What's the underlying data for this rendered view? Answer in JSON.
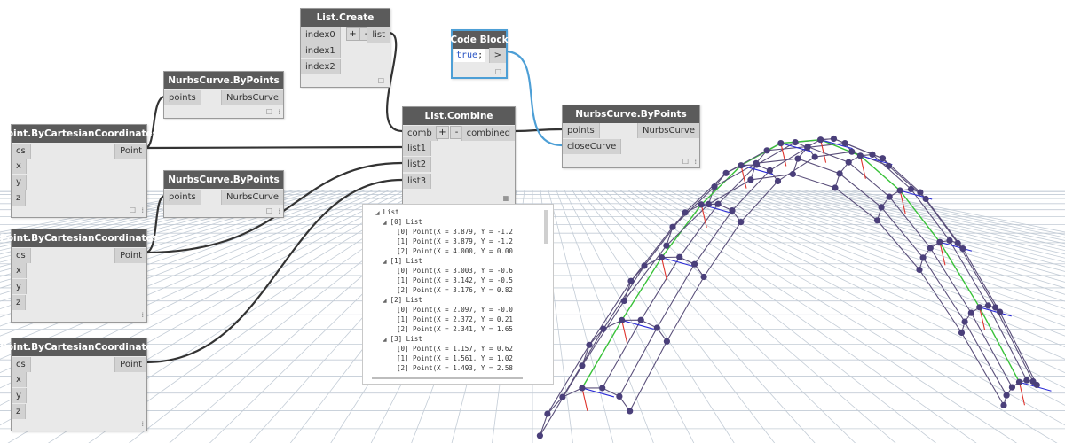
{
  "nodes": {
    "point1": {
      "title": "Point.ByCartesianCoordinates",
      "inputs": [
        "cs",
        "x",
        "y",
        "z"
      ],
      "output": "Point"
    },
    "point2": {
      "title": "Point.ByCartesianCoordinates",
      "inputs": [
        "cs",
        "x",
        "y",
        "z"
      ],
      "output": "Point"
    },
    "point3": {
      "title": "Point.ByCartesianCoordinates",
      "inputs": [
        "cs",
        "x",
        "y",
        "z"
      ],
      "output": "Point"
    },
    "nurbs1": {
      "title": "NurbsCurve.ByPoints",
      "inputs": [
        "points"
      ],
      "output": "NurbsCurve"
    },
    "nurbs2": {
      "title": "NurbsCurve.ByPoints",
      "inputs": [
        "points"
      ],
      "output": "NurbsCurve"
    },
    "nurbs3": {
      "title": "NurbsCurve.ByPoints",
      "inputs": [
        "points",
        "closeCurve"
      ],
      "output": "NurbsCurve"
    },
    "list_create": {
      "title": "List.Create",
      "inputs": [
        "index0",
        "index1",
        "index2"
      ],
      "output": "list",
      "plus": "+",
      "minus": "-"
    },
    "list_combine": {
      "title": "List.Combine",
      "inputs": [
        "comb",
        "list1",
        "list2",
        "list3"
      ],
      "output": "combined",
      "plus": "+",
      "minus": "-"
    },
    "code_block": {
      "title": "Code Block",
      "code_keyword": "true",
      "code_suffix": ";",
      "output": ">"
    }
  },
  "watch": {
    "lines": [
      {
        "text": "List",
        "indent": 0,
        "toggle": true
      },
      {
        "text": "[0] List",
        "indent": 1,
        "toggle": true
      },
      {
        "text": "[0] Point(X = 3.879, Y = -1.2",
        "indent": 3,
        "toggle": false
      },
      {
        "text": "[1] Point(X = 3.879, Y = -1.2",
        "indent": 3,
        "toggle": false
      },
      {
        "text": "[2] Point(X = 4.000, Y = 0.00",
        "indent": 3,
        "toggle": false
      },
      {
        "text": "[1] List",
        "indent": 1,
        "toggle": true
      },
      {
        "text": "[0] Point(X = 3.003, Y = -0.6",
        "indent": 3,
        "toggle": false
      },
      {
        "text": "[1] Point(X = 3.142, Y = -0.5",
        "indent": 3,
        "toggle": false
      },
      {
        "text": "[2] Point(X = 3.176, Y = 0.82",
        "indent": 3,
        "toggle": false
      },
      {
        "text": "[2] List",
        "indent": 1,
        "toggle": true
      },
      {
        "text": "[0] Point(X = 2.097, Y = -0.0",
        "indent": 3,
        "toggle": false
      },
      {
        "text": "[1] Point(X = 2.372, Y = 0.21",
        "indent": 3,
        "toggle": false
      },
      {
        "text": "[2] Point(X = 2.341, Y = 1.65",
        "indent": 3,
        "toggle": false
      },
      {
        "text": "[3] List",
        "indent": 1,
        "toggle": true
      },
      {
        "text": "[0] Point(X = 1.157, Y = 0.62",
        "indent": 3,
        "toggle": false
      },
      {
        "text": "[1] Point(X = 1.561, Y = 1.02",
        "indent": 3,
        "toggle": false
      },
      {
        "text": "[2] Point(X = 1.493, Y = 2.58",
        "indent": 3,
        "toggle": false
      }
    ]
  },
  "colors": {
    "node_header": "#5b5b5b",
    "node_body": "#e9e9e9",
    "selected_border": "#4d9fd6",
    "wire": "#333333",
    "selected_wire": "#4d9fd6",
    "grid": "#c3ccd6",
    "curve": "#5a4f7a",
    "point": "#4a3f7a",
    "green_axis": "#39c239",
    "red_axis": "#e0332c",
    "blue_axis": "#2b2bd6",
    "code_keyword": "#2a55c4"
  }
}
